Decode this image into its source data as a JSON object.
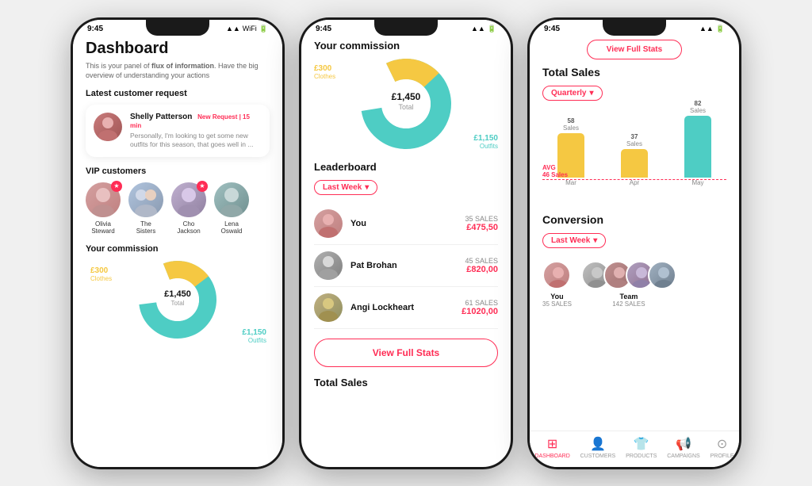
{
  "phone1": {
    "status": {
      "time": "9:45",
      "icons": "▲▲ ✦ ▮"
    },
    "title": "Dashboard",
    "subtitle": "This is your panel of flux of information. Have the big overview of understanding your actions",
    "sections": {
      "latest": "Latest customer request",
      "vip": "VIP customers",
      "commission": "Your commission"
    },
    "customer": {
      "name": "Shelly Patterson",
      "badge": "New Request | 15 min",
      "text": "Personally, I'm looking to get some new outfits for this season, that goes well in ..."
    },
    "vip_customers": [
      {
        "name": "Olivia\nSteward",
        "color": "av-olivia"
      },
      {
        "name": "The\nSisters",
        "color": "av-sisters"
      },
      {
        "name": "Cho\nJackson",
        "color": "av-cho"
      },
      {
        "name": "Lena\nOswald",
        "color": "av-lena"
      }
    ],
    "donut": {
      "total_label": "£1,450",
      "total_sub": "Total",
      "clothes_label": "£300",
      "clothes_sub": "Clothes",
      "outfits_label": "£1,150",
      "outfits_sub": "Outfits"
    }
  },
  "phone2": {
    "commission_title": "Your commission",
    "donut": {
      "total_label": "£1,450",
      "total_sub": "Total",
      "clothes_label": "£300",
      "clothes_sub": "Clothes",
      "outfits_label": "£1,150",
      "outfits_sub": "Outfits"
    },
    "leaderboard": {
      "title": "Leaderboard",
      "filter": "Last Week",
      "rows": [
        {
          "name": "You",
          "sales_count": "35 SALES",
          "sales_value": "£475,50",
          "color": "av-you"
        },
        {
          "name": "Pat\nBrohan",
          "sales_count": "45 SALES",
          "sales_value": "£820,00",
          "color": "av-pat"
        },
        {
          "name": "Angi\nLockheart",
          "sales_count": "61 SALES",
          "sales_value": "£1020,00",
          "color": "av-angi"
        }
      ],
      "view_btn": "View Full Stats"
    },
    "total_sales": "Total Sales"
  },
  "phone3": {
    "view_btn": "View Full Stats",
    "total_sales": {
      "title": "Total Sales",
      "filter": "Quarterly",
      "avg_label": "AVG",
      "avg_value": "46 Sales",
      "bars": [
        {
          "month": "Mar",
          "value": 58,
          "label": "58\nSales",
          "color": "#f5c842"
        },
        {
          "month": "Apr",
          "value": 37,
          "label": "37\nSales",
          "color": "#f5c842"
        },
        {
          "month": "May",
          "value": 82,
          "label": "82\nSales",
          "color": "#4ecdc4"
        }
      ]
    },
    "conversion": {
      "title": "Conversion",
      "filter": "Last Week",
      "you": {
        "name": "You",
        "sales": "35 SALES"
      },
      "team": {
        "name": "Team",
        "sales": "142 SALES"
      }
    },
    "nav": [
      {
        "label": "DASHBOARD",
        "icon": "⊞",
        "active": true
      },
      {
        "label": "CUSTOMERS",
        "icon": "👤",
        "active": false
      },
      {
        "label": "PRODUCTS",
        "icon": "👕",
        "active": false
      },
      {
        "label": "CAMPAIGNS",
        "icon": "📢",
        "active": false
      },
      {
        "label": "PROFILE",
        "icon": "⊙",
        "active": false
      }
    ]
  }
}
